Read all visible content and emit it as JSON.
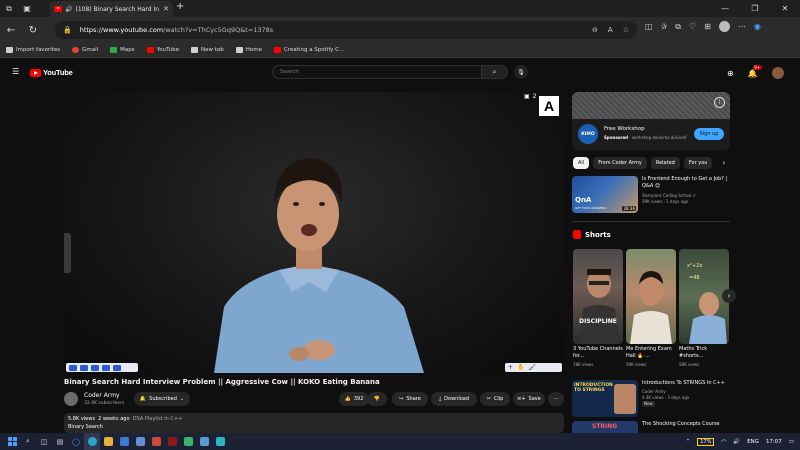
{
  "browser": {
    "tab_title": "(108) Binary Search Hard In",
    "url_host": "https://www.youtube.com",
    "url_path": "/watch?v=ThCyc5Gq9Q&t=1378s",
    "bookmarks": [
      {
        "label": "Import favorites",
        "icon_color": "#cfcfcf"
      },
      {
        "label": "Gmail",
        "icon_color": "#ea4335"
      },
      {
        "label": "Maps",
        "icon_color": "#34a853"
      },
      {
        "label": "YouTube",
        "icon_color": "#ff0000"
      },
      {
        "label": "New tab",
        "icon_color": "#cfcfcf"
      },
      {
        "label": "Home",
        "icon_color": "#cfcfcf"
      },
      {
        "label": "Creating a Spotify C...",
        "icon_color": "#ff0000"
      }
    ]
  },
  "yt": {
    "logo_text": "YouTube",
    "search_placeholder": "Search",
    "notif_count": "9+"
  },
  "video": {
    "title": "Binary Search Hard Interview Problem || Aggressive Cow || KOKO Eating Banana",
    "channel": "Coder Army",
    "subscribers": "32.4K subscribers",
    "subscribed_label": "Subscribed",
    "likes": "392",
    "share_label": "Share",
    "download_label": "Download",
    "clip_label": "Clip",
    "save_label": "Save",
    "views": "5.8K views",
    "posted": "2 weeks ago",
    "tags": "DSA Playlist in C++",
    "desc_text": "Binary Search",
    "overlay_number": "2"
  },
  "ad": {
    "logo_text": "KIMO",
    "title": "Free Workshop",
    "sponsored": "Sponsored",
    "domain": "workshop.devkimo.ai/Live/f",
    "button": "Sign up"
  },
  "chips": [
    "All",
    "From Coder Army",
    "Related",
    "For you"
  ],
  "recommended": [
    {
      "title": "Is Frontend Enough to Get a Job? | Q&A 😊",
      "channel": "Sheryians Coding School ✔",
      "meta": "39K views · 1 days ago",
      "duration": "28:36",
      "thumb_text": "QnA",
      "thumb_sub": "GET YOUR ANSWERS"
    }
  ],
  "shorts": {
    "title": "Shorts",
    "items": [
      {
        "caption": "3 YouTube Channels for...",
        "views": "78K views",
        "thumb_text": "DISCIPLINE"
      },
      {
        "caption": "Me Entering Exam Hall 🔥 ...",
        "views": "59K views",
        "thumb_text": ""
      },
      {
        "caption": "Maths Trick #shorts...",
        "views": "58K views",
        "thumb_text": ""
      }
    ]
  },
  "recommended_more": [
    {
      "title": "Introductions To STRINGS In C++",
      "channel": "Coder Army",
      "meta": "4.4K views · 3 days ago",
      "badge": "New",
      "thumb_text": "INTRODUCTION TO STRINGS"
    },
    {
      "title": "The Shocking Concepts Course",
      "thumb_text": "STRING"
    }
  ],
  "taskbar": {
    "battery": "17%",
    "lang": "ENG",
    "time": "17:07"
  }
}
